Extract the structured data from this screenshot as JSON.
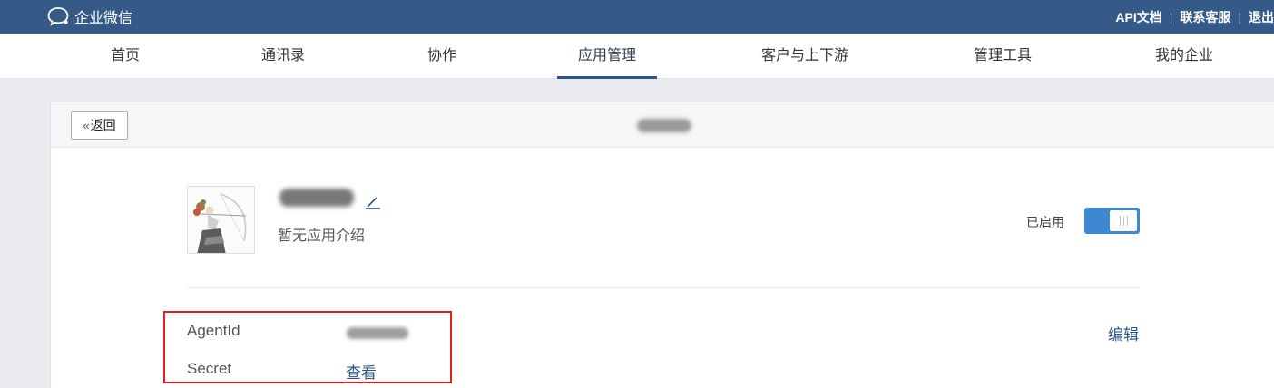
{
  "brand": {
    "name": "企业微信",
    "icon": "chat-bubble-icon"
  },
  "top_links": [
    "API文档",
    "联系客服",
    "退出"
  ],
  "nav": {
    "items": [
      "首页",
      "通讯录",
      "协作",
      "应用管理",
      "客户与上下游",
      "管理工具",
      "我的企业"
    ],
    "active": "应用管理"
  },
  "card": {
    "back_label": "返回",
    "back_icon": "double-chevron-left-icon"
  },
  "app": {
    "intro": "暂无应用介绍",
    "edit_icon": "pencil-icon",
    "status_label": "已启用",
    "enabled": true
  },
  "details": {
    "agentid_label": "AgentId",
    "secret_label": "Secret",
    "secret_action": "查看",
    "edit_label": "编辑"
  },
  "colors": {
    "topbar": "#355a87",
    "accent": "#2d5588",
    "toggle": "#3d88d0",
    "highlight": "#e02020"
  }
}
